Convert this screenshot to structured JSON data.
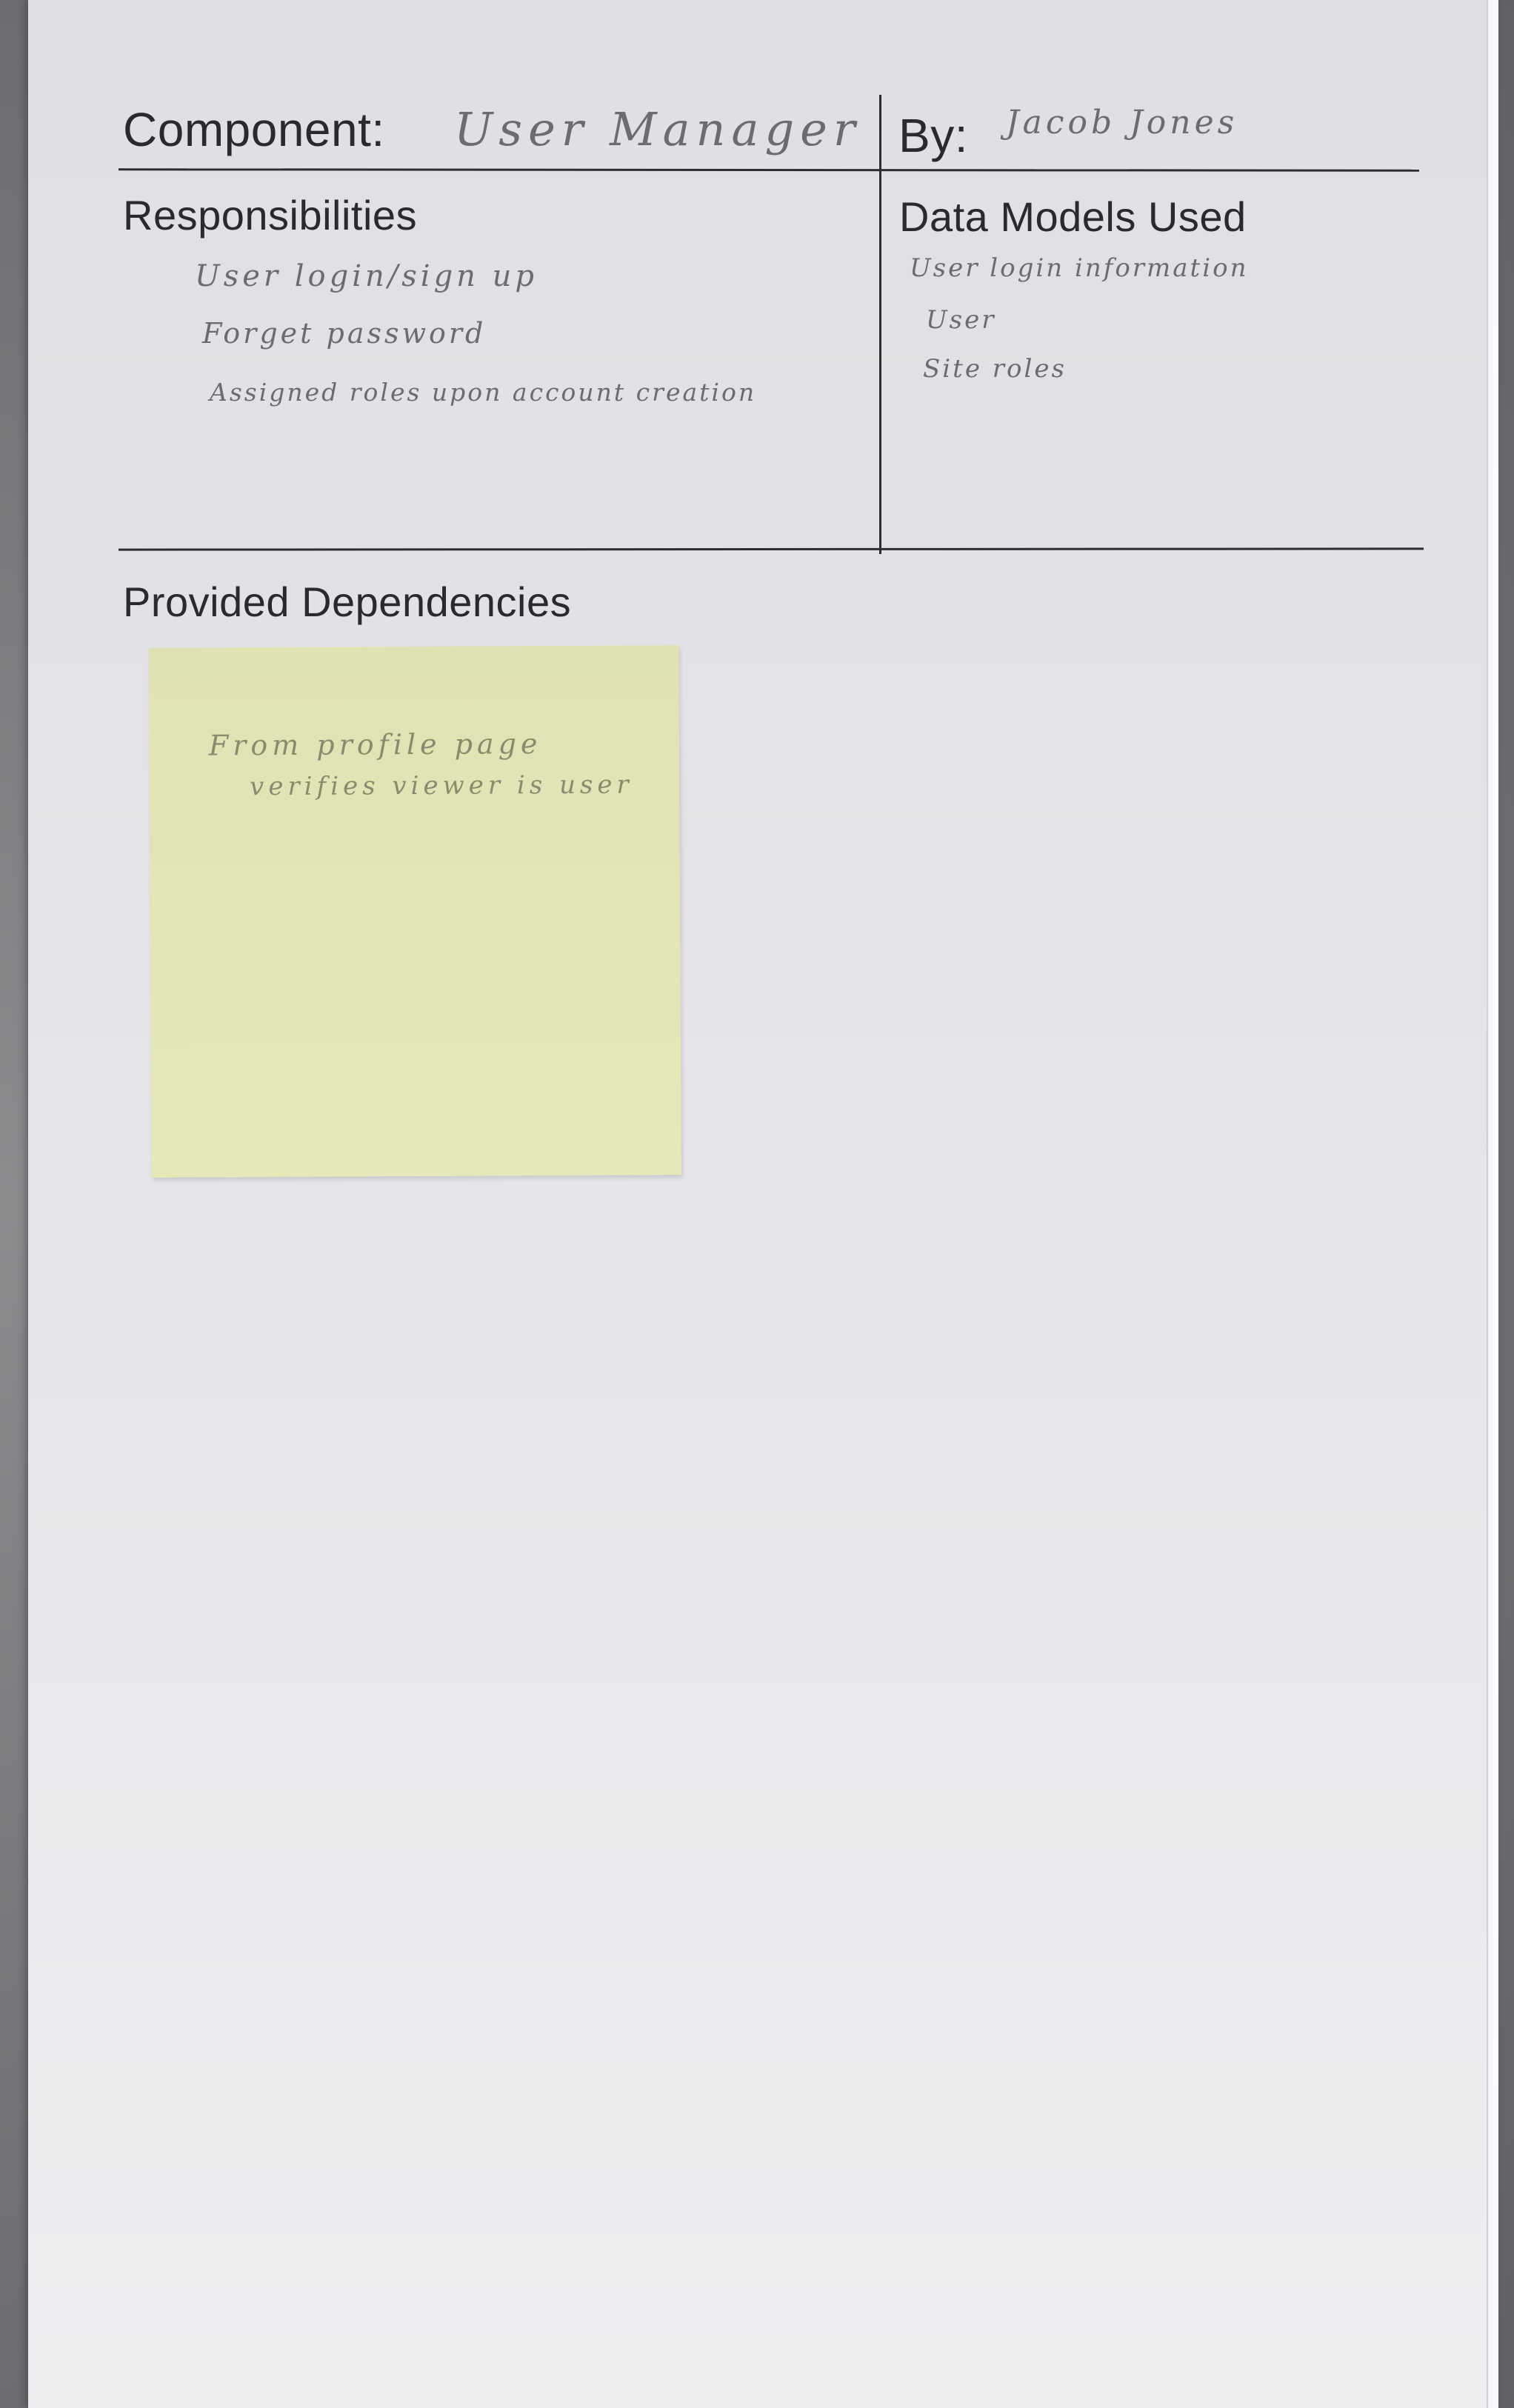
{
  "card": {
    "component_label": "Component:",
    "component_value": "User Manager",
    "by_label": "By:",
    "by_value": "Jacob Jones",
    "responsibilities": {
      "heading": "Responsibilities",
      "items": [
        "User login/sign up",
        "Forget password",
        "Assigned roles upon account creation"
      ]
    },
    "data_models": {
      "heading": "Data Models Used",
      "items": [
        "User login information",
        "User",
        "Site roles"
      ]
    },
    "dependencies": {
      "heading": "Provided Dependencies",
      "sticky_note": {
        "lines": [
          "From profile page",
          "verifies viewer is user"
        ]
      }
    }
  }
}
